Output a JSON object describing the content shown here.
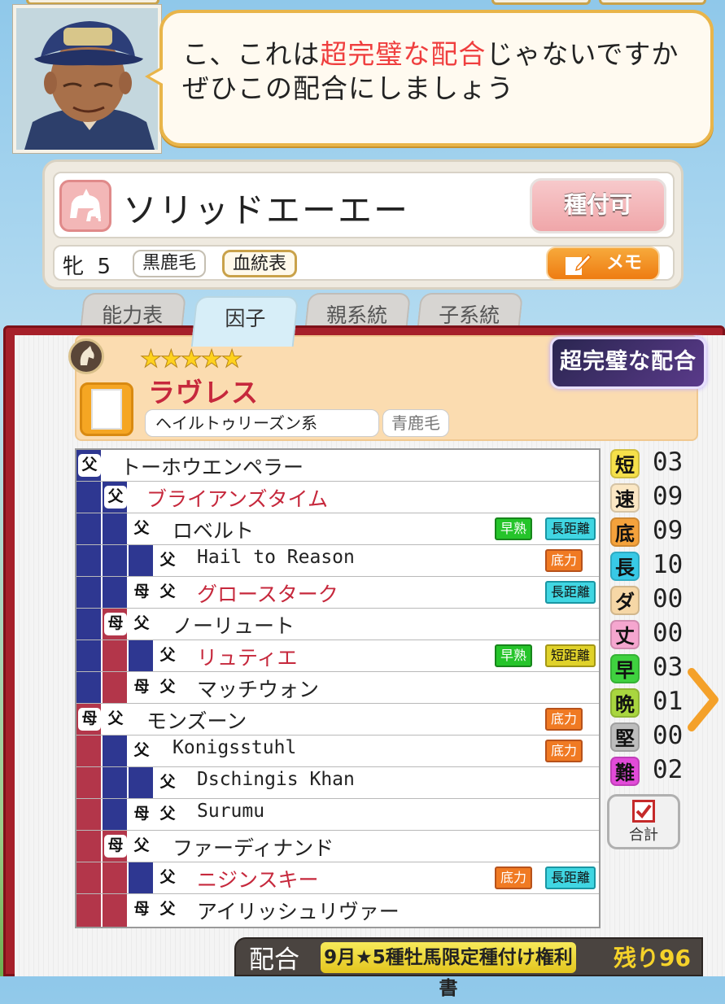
{
  "speech": {
    "line1_pre": "こ、これは",
    "line1_hl": "超完璧な配合",
    "line1_post": "じゃないですか",
    "line2": "ぜひこの配合にしましょう"
  },
  "horse": {
    "name": "ソリッドエーエー",
    "breed_button": "種付可",
    "sex": "牝",
    "age": "5",
    "coat": "黒鹿毛",
    "pedigree_button": "血統表",
    "memo_button": "メモ"
  },
  "tabs": [
    "能力表",
    "因子",
    "親系統",
    "子系統"
  ],
  "sire": {
    "stars": "★★★★★",
    "name": "ラヴレス",
    "line": "ヘイルトゥリーズン系",
    "coat": "青鹿毛",
    "perfect_badge": "超完璧な配合"
  },
  "pedigree": {
    "father_mark": "父",
    "mother_mark": "母",
    "rows": [
      {
        "name": "トーホウエンペラー",
        "factors": []
      },
      {
        "name": "ブライアンズタイム",
        "factors": []
      },
      {
        "name": "ロベルト",
        "factors": [
          "早熟",
          "長距離"
        ]
      },
      {
        "name": "Hail to Reason",
        "factors": [
          "底力"
        ]
      },
      {
        "name": "グロースターク",
        "factors": [
          "長距離"
        ]
      },
      {
        "name": "ノーリュート",
        "factors": []
      },
      {
        "name": "リュティエ",
        "factors": [
          "早熟",
          "短距離"
        ]
      },
      {
        "name": "マッチウォン",
        "factors": []
      },
      {
        "name": "モンズーン",
        "factors": [
          "底力"
        ]
      },
      {
        "name": "Konigsstuhl",
        "factors": [
          "底力"
        ]
      },
      {
        "name": "Dschingis Khan",
        "factors": []
      },
      {
        "name": "Surumu",
        "factors": []
      },
      {
        "name": "ファーディナンド",
        "factors": []
      },
      {
        "name": "ニジンスキー",
        "factors": [
          "底力",
          "長距離"
        ]
      },
      {
        "name": "アイリッシュリヴァー",
        "factors": []
      }
    ]
  },
  "stats": [
    {
      "label": "短",
      "value": "03",
      "color": "#f5e04a"
    },
    {
      "label": "速",
      "value": "09",
      "color": "#fbe7c4"
    },
    {
      "label": "底",
      "value": "09",
      "color": "#f4a23c"
    },
    {
      "label": "長",
      "value": "10",
      "color": "#38c9e6"
    },
    {
      "label": "ダ",
      "value": "00",
      "color": "#f6d7a6"
    },
    {
      "label": "丈",
      "value": "00",
      "color": "#f5a6cf"
    },
    {
      "label": "早",
      "value": "03",
      "color": "#3fd23f"
    },
    {
      "label": "晩",
      "value": "01",
      "color": "#a9d63f"
    },
    {
      "label": "堅",
      "value": "00",
      "color": "#bdbdbd"
    },
    {
      "label": "難",
      "value": "02",
      "color": "#e24bd9"
    }
  ],
  "total_button": "合計",
  "footer": {
    "label": "配合",
    "ticket": "9月★5種牡馬限定種付け権利書",
    "remaining": "残り96"
  }
}
